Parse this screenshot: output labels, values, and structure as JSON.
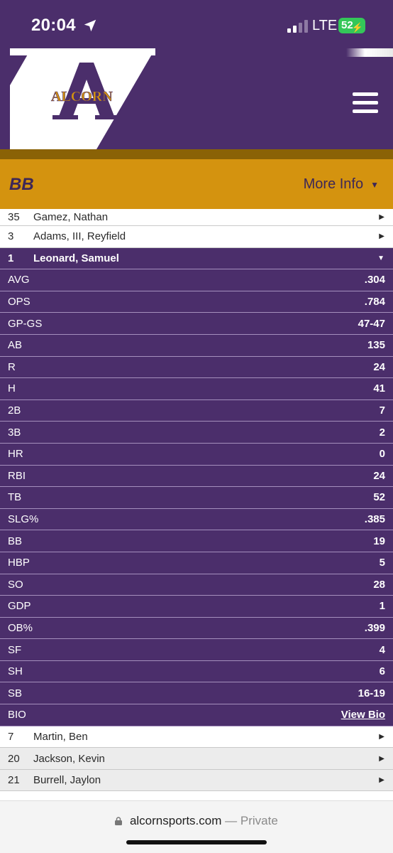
{
  "status": {
    "time": "20:04",
    "network": "LTE",
    "battery": "52"
  },
  "header": {
    "logo_text": "ALCORN",
    "colors": {
      "purple": "#4b2e6b",
      "gold": "#d4930f"
    }
  },
  "section": {
    "title": "BB",
    "more_info": "More Info"
  },
  "roster": {
    "before": [
      {
        "number": "35",
        "name": "Gamez, Nathan"
      },
      {
        "number": "3",
        "name": "Adams, III, Reyfield"
      }
    ],
    "selected": {
      "number": "1",
      "name": "Leonard, Samuel"
    },
    "stats": [
      {
        "label": "AVG",
        "value": ".304"
      },
      {
        "label": "OPS",
        "value": ".784"
      },
      {
        "label": "GP-GS",
        "value": "47-47"
      },
      {
        "label": "AB",
        "value": "135"
      },
      {
        "label": "R",
        "value": "24"
      },
      {
        "label": "H",
        "value": "41"
      },
      {
        "label": "2B",
        "value": "7"
      },
      {
        "label": "3B",
        "value": "2"
      },
      {
        "label": "HR",
        "value": "0"
      },
      {
        "label": "RBI",
        "value": "24"
      },
      {
        "label": "TB",
        "value": "52"
      },
      {
        "label": "SLG%",
        "value": ".385"
      },
      {
        "label": "BB",
        "value": "19"
      },
      {
        "label": "HBP",
        "value": "5"
      },
      {
        "label": "SO",
        "value": "28"
      },
      {
        "label": "GDP",
        "value": "1"
      },
      {
        "label": "OB%",
        "value": ".399"
      },
      {
        "label": "SF",
        "value": "4"
      },
      {
        "label": "SH",
        "value": "6"
      },
      {
        "label": "SB",
        "value": "16-19"
      }
    ],
    "bio": {
      "label": "BIO",
      "link": "View Bio"
    },
    "after": [
      {
        "number": "7",
        "name": "Martin, Ben"
      },
      {
        "number": "20",
        "name": "Jackson, Kevin"
      },
      {
        "number": "21",
        "name": "Burrell, Jaylon"
      }
    ]
  },
  "browser": {
    "domain": "alcornsports.com",
    "separator": "—",
    "mode": "Private"
  }
}
